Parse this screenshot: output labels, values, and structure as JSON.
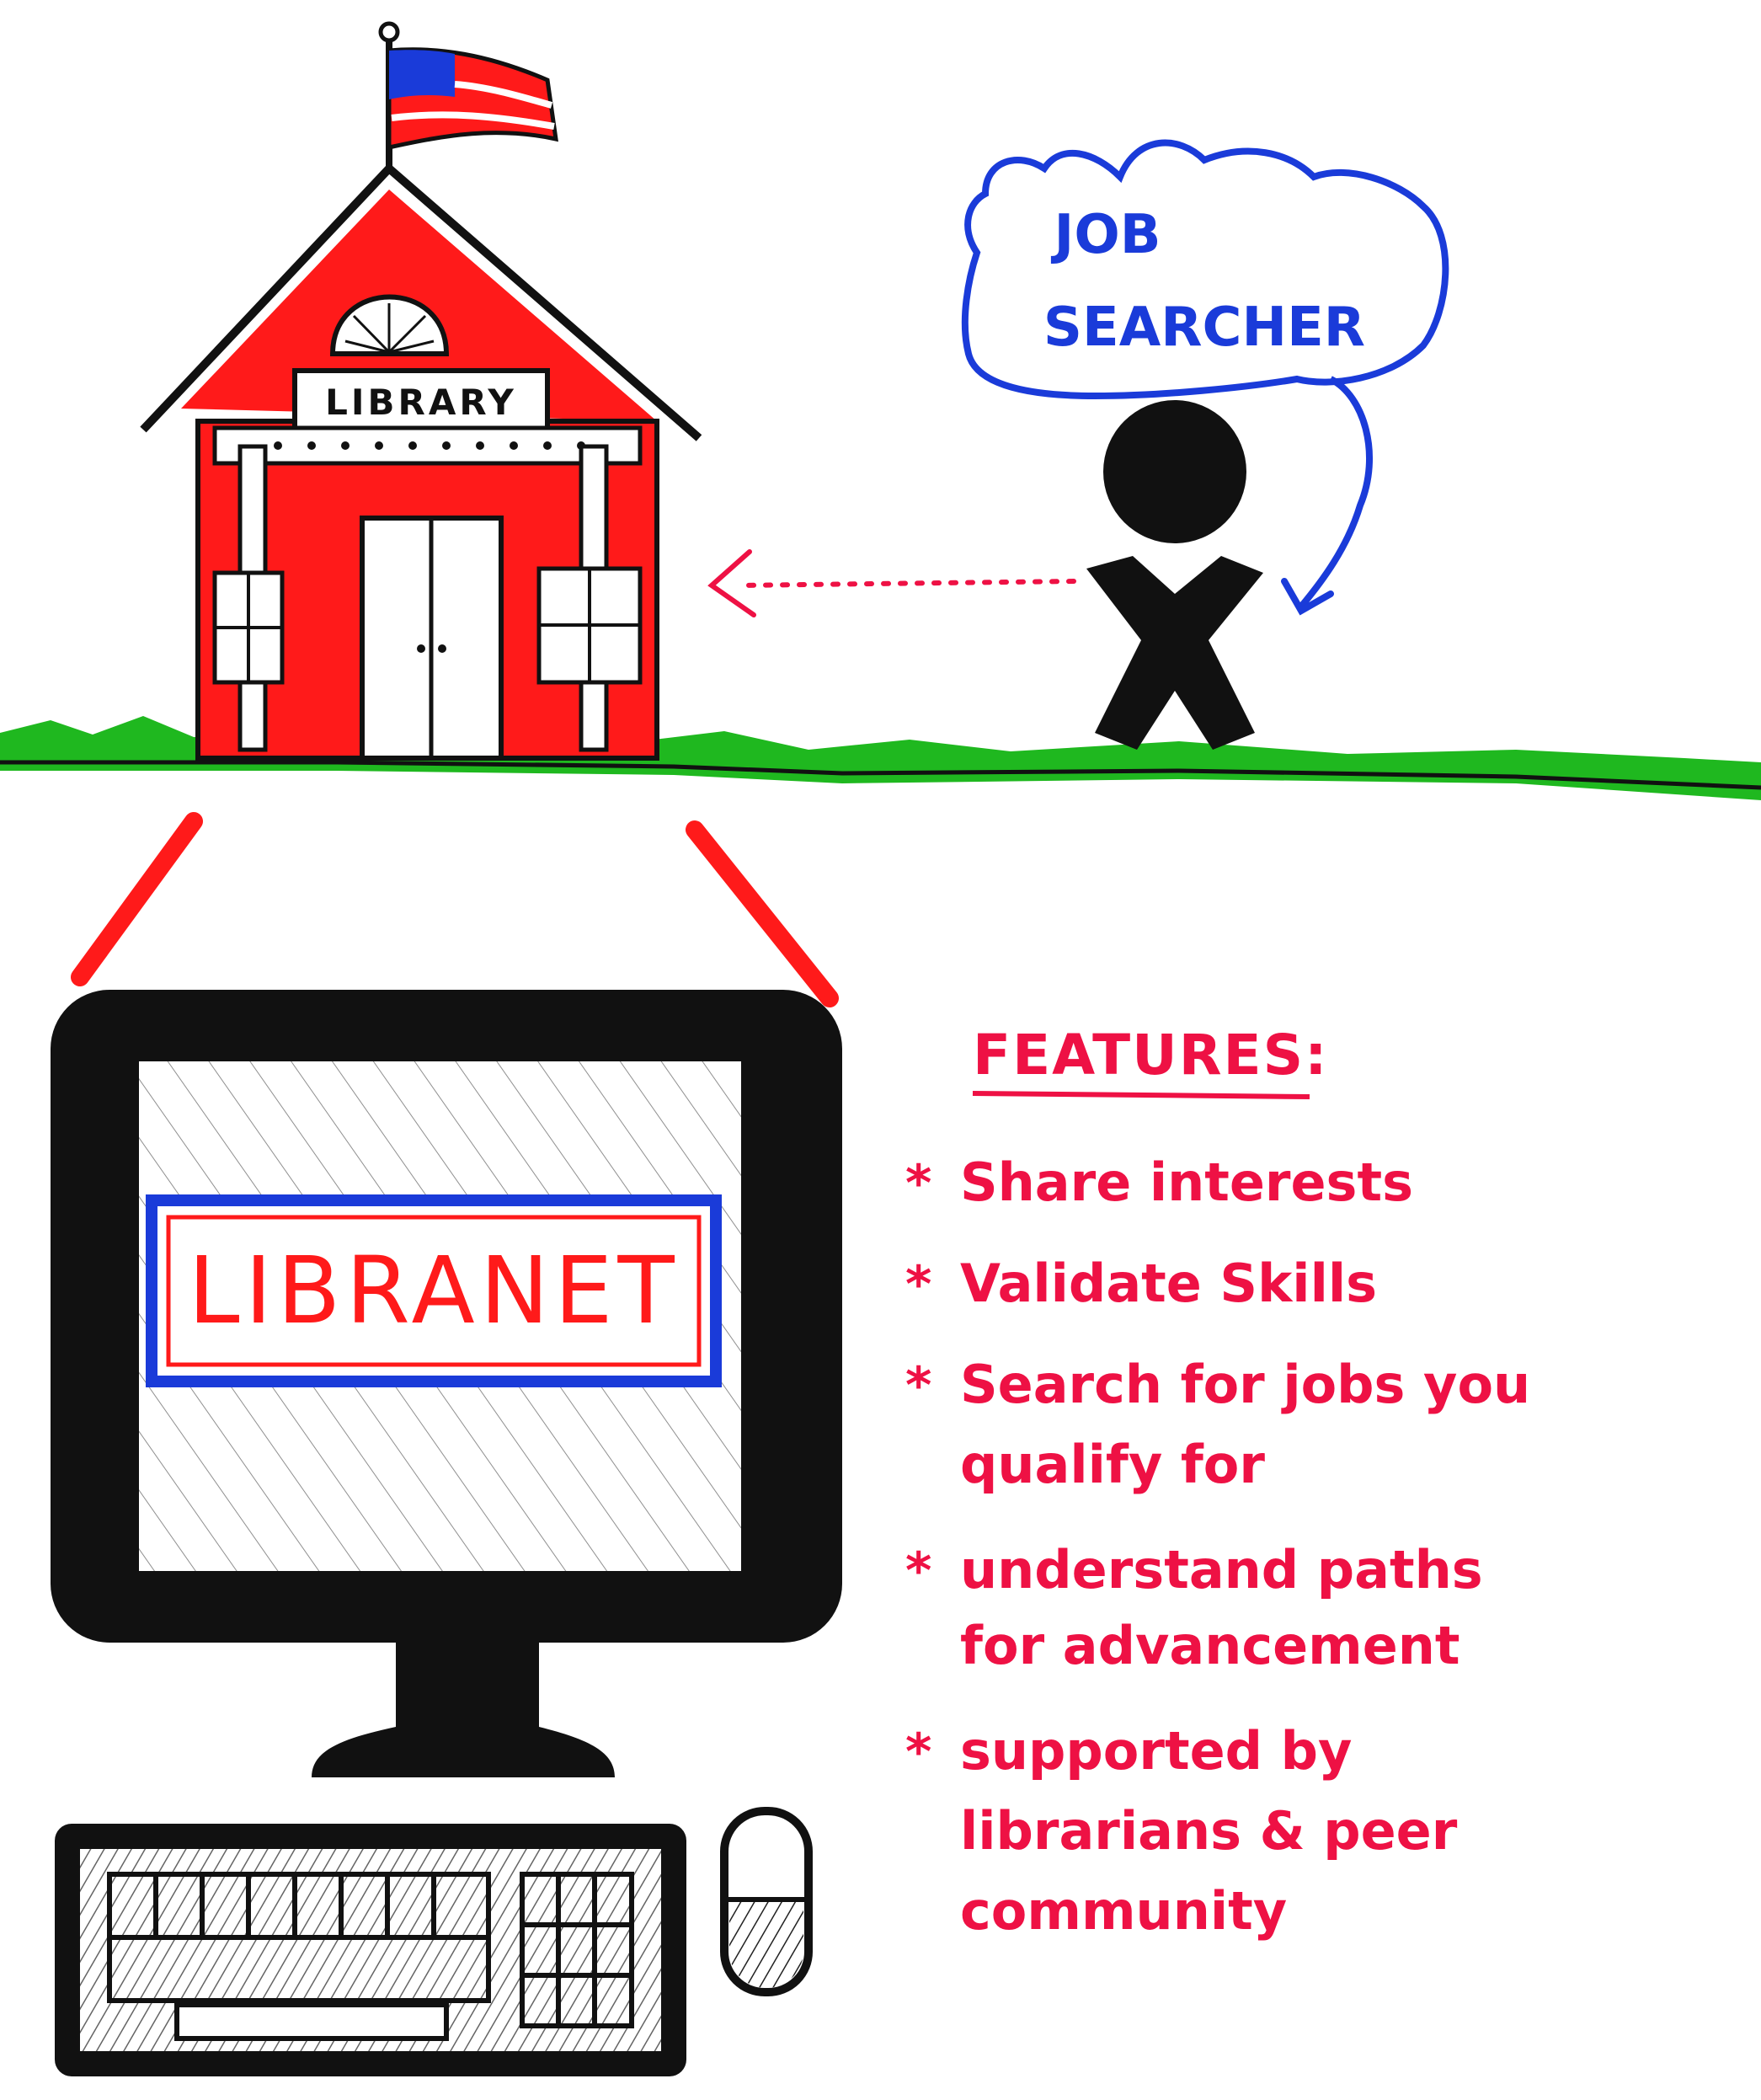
{
  "library": {
    "sign": "LIBRARY"
  },
  "bubble": {
    "line1": "JOB",
    "line2": "SEARCHER"
  },
  "screen": {
    "brand": "LIBRANET"
  },
  "features": {
    "heading": "FEATURES:",
    "items": [
      {
        "line1": "Share interests",
        "line2": ""
      },
      {
        "line1": "Validate Skills",
        "line2": ""
      },
      {
        "line1": "Search for jobs you",
        "line2": "qualify for"
      },
      {
        "line1": "understand paths",
        "line2": "for advancement"
      },
      {
        "line1": "supported by",
        "line2": "librarians & peer",
        "line3": "community"
      }
    ]
  },
  "colors": {
    "red": "#ff1a1a",
    "feature_red": "#ee1144",
    "blue": "#1a3bd9",
    "green": "#1fb81f",
    "ink": "#111111"
  }
}
